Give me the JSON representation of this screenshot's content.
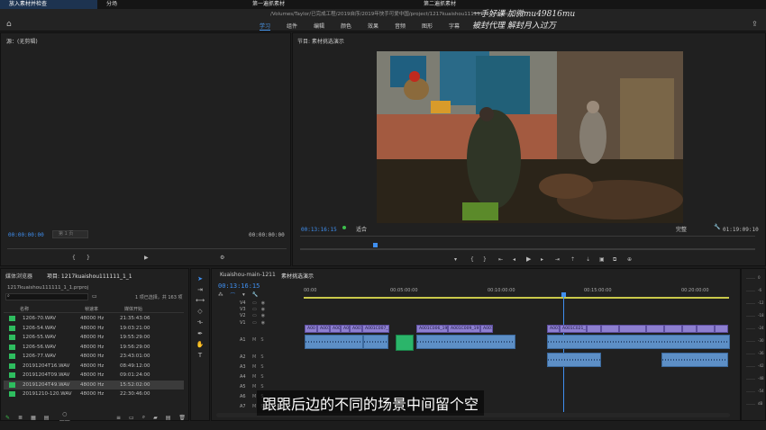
{
  "window_tabs": [
    "放入素材并检查",
    "分场",
    "第一遍抓素材",
    "第二遍抓素材"
  ],
  "path": "/Volumes/Taylor/已完成工程/2019自序/2019年快手可爱中国/project/1217kuaishou111111_1_1.prproj",
  "workspaces": [
    "学习",
    "组件",
    "编辑",
    "颜色",
    "效果",
    "音频",
    "图形",
    "字幕"
  ],
  "watermark": {
    "line1": "一手好课 加微mu49816mu",
    "line2": "被封代理 解封月入过万"
  },
  "source_panel": {
    "title": "源：(无剪辑)",
    "tc_left": "00:00:00:00",
    "tc_right": "00:00:00:00",
    "page": "第 1 页"
  },
  "program_panel": {
    "title": "节目: 素材挑选演示",
    "tc": "00:13:16:15",
    "fit": "适合",
    "quality": "完整",
    "duration": "01:19:09:10"
  },
  "project_panel": {
    "tabs": [
      "媒体浏览器",
      "项目: 1217kuaishou111111_1_1"
    ],
    "file": "1217kuaishou111111_1_1.prproj",
    "selection": "1 项已选择，共 163 项",
    "columns": [
      "名称",
      "帧速率",
      "媒体开始"
    ],
    "rows": [
      {
        "name": "1206-70.WAV",
        "rate": "48000 Hz",
        "start": "21:35:43:06"
      },
      {
        "name": "1206-54.WAV",
        "rate": "48000 Hz",
        "start": "19:03:21:00"
      },
      {
        "name": "1206-55.WAV",
        "rate": "48000 Hz",
        "start": "19:55:29:00"
      },
      {
        "name": "1206-56.WAV",
        "rate": "48000 Hz",
        "start": "19:56:29:00"
      },
      {
        "name": "1206-77.WAV",
        "rate": "48000 Hz",
        "start": "23:43:01:00"
      },
      {
        "name": "20191204T16.WAV",
        "rate": "48000 Hz",
        "start": "08:49:12:00"
      },
      {
        "name": "20191204T09.WAV",
        "rate": "48000 Hz",
        "start": "09:01:24:00"
      },
      {
        "name": "20191204T49.WAV",
        "rate": "48000 Hz",
        "start": "15:52:02:00"
      },
      {
        "name": "20191210-120.WAV",
        "rate": "48000 Hz",
        "start": "22:30:46:00"
      }
    ]
  },
  "timeline": {
    "tabs": [
      "Kuaishou-main-1211",
      "素材挑选演示"
    ],
    "tc": "00:13:16:15",
    "ruler": [
      "00:00",
      "00:05:00:00",
      "00:10:00:00",
      "00:15:00:00",
      "00:20:00:00"
    ],
    "tracks": [
      "V4",
      "V3",
      "V2",
      "V1",
      "A1",
      "A2",
      "A3",
      "A4",
      "A5",
      "A6",
      "A7"
    ],
    "clip_labels": [
      "A00",
      "A001C0",
      "A001C",
      "A00",
      "A001C",
      "A001C007_19",
      "A001C006_191",
      "A001C009_191201",
      "A001C",
      "A001C",
      "A001C021_191"
    ]
  },
  "meter_labels": [
    "0",
    "-6",
    "-12",
    "-18",
    "-24",
    "-30",
    "-36",
    "-42",
    "-48",
    "-54",
    "dB"
  ],
  "subtitle": "跟跟后边的不同的场景中间留个空"
}
